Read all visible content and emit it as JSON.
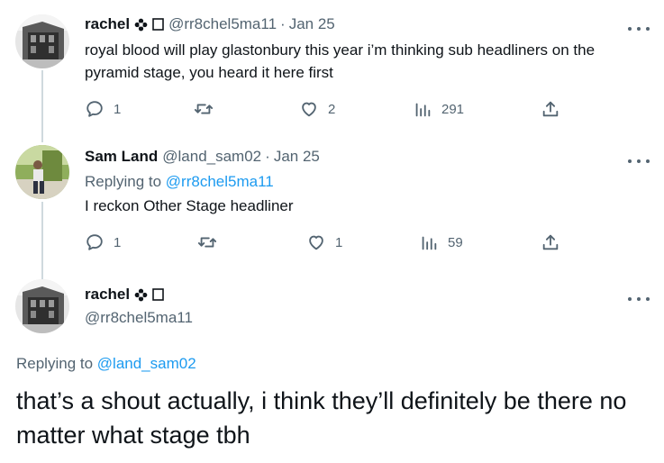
{
  "tweets": [
    {
      "name": "rachel",
      "handle": "@rr8chel5ma11",
      "dot": "·",
      "time": "Jan 25",
      "text": "royal blood will play glastonbury this year i’m thinking sub headliners on the pyramid stage, you heard it here first",
      "replies": "1",
      "retweets": "",
      "likes": "2",
      "views": "291"
    },
    {
      "name": "Sam Land",
      "handle": "@land_sam02",
      "dot": "·",
      "time": "Jan 25",
      "replying_prefix": "Replying to ",
      "replying_to": "@rr8chel5ma11",
      "text": "I reckon Other Stage headliner",
      "replies": "1",
      "retweets": "",
      "likes": "1",
      "views": "59"
    },
    {
      "name": "rachel",
      "handle": "@rr8chel5ma11",
      "replying_prefix": "Replying to ",
      "replying_to": "@land_sam02",
      "text": "that’s a shout actually, i think they’ll definitely be there no matter what stage tbh"
    }
  ],
  "colors": {
    "link": "#1d9bf0",
    "muted": "#536471",
    "text": "#0f1419",
    "thread_line": "#cfd9de"
  },
  "icons": [
    "flower-badge-icon",
    "square-badge-icon",
    "more-icon",
    "reply-icon",
    "retweet-icon",
    "like-icon",
    "views-icon",
    "share-icon"
  ]
}
